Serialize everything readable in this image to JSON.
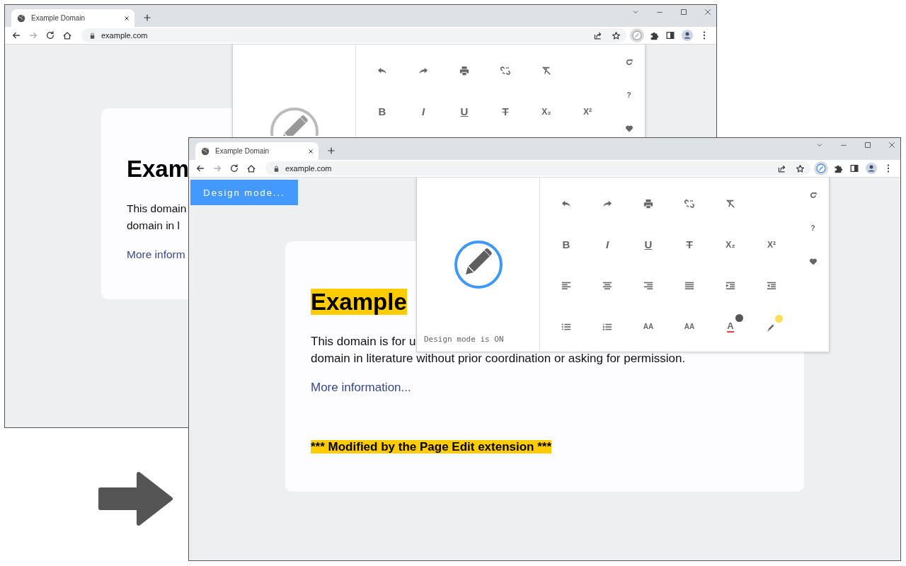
{
  "windows": [
    {
      "tab": {
        "title": "Example Domain"
      },
      "address": "example.com",
      "forward_enabled": false,
      "extension_active": false,
      "page": {
        "blocks": [
          {
            "kind": "heading",
            "text": "Exam",
            "highlighted": false
          },
          {
            "kind": "paragraph",
            "lines": [
              "This domain",
              "domain in l"
            ]
          },
          {
            "kind": "link",
            "text": "More inform"
          }
        ]
      },
      "popup": {
        "design_mode": false,
        "rows": [
          [
            {
              "kind": "undo"
            },
            {
              "kind": "redo"
            },
            {
              "kind": "print"
            },
            {
              "kind": "unlink"
            },
            {
              "kind": "clear-format"
            }
          ],
          [
            {
              "kind": "glyph",
              "label": "B"
            },
            {
              "kind": "glyph",
              "label": "I"
            },
            {
              "kind": "glyph",
              "label": "U"
            },
            {
              "kind": "glyph",
              "label": "T"
            },
            {
              "kind": "glyph",
              "label": "X₂"
            },
            {
              "kind": "glyph",
              "label": "X²"
            }
          ]
        ],
        "side": [
          {
            "kind": "refresh"
          },
          {
            "kind": "glyph",
            "label": "?"
          },
          {
            "kind": "heart"
          }
        ]
      }
    },
    {
      "tab": {
        "title": "Example Domain"
      },
      "address": "example.com",
      "forward_enabled": false,
      "extension_active": true,
      "banner": "Design mode...",
      "page": {
        "blocks": [
          {
            "kind": "heading",
            "text": "Example",
            "highlighted": true
          },
          {
            "kind": "paragraph",
            "lines": [
              "This domain is for u",
              "domain in literature without prior coordination or asking for permission."
            ]
          },
          {
            "kind": "link",
            "text": "More information..."
          },
          {
            "kind": "note",
            "text": "*** Modified by the Page Edit extension ***",
            "highlighted": true
          }
        ]
      },
      "popup": {
        "design_mode": true,
        "status": "Design mode is ON",
        "rows": [
          [
            {
              "kind": "undo"
            },
            {
              "kind": "redo"
            },
            {
              "kind": "print"
            },
            {
              "kind": "unlink"
            },
            {
              "kind": "clear-format"
            }
          ],
          [
            {
              "kind": "glyph",
              "label": "B"
            },
            {
              "kind": "glyph",
              "label": "I"
            },
            {
              "kind": "glyph",
              "label": "U"
            },
            {
              "kind": "glyph",
              "label": "T"
            },
            {
              "kind": "glyph",
              "label": "X₂"
            },
            {
              "kind": "glyph",
              "label": "X²"
            }
          ],
          [
            {
              "kind": "align-left"
            },
            {
              "kind": "align-center"
            },
            {
              "kind": "align-right"
            },
            {
              "kind": "justify"
            },
            {
              "kind": "indent"
            },
            {
              "kind": "outdent"
            }
          ],
          [
            {
              "kind": "bullets"
            },
            {
              "kind": "numbers"
            },
            {
              "kind": "glyph",
              "label": "AA"
            },
            {
              "kind": "glyph",
              "label": "AA"
            },
            {
              "kind": "text-color",
              "label": "A",
              "color": "#555555"
            },
            {
              "kind": "highlight",
              "color": "#ffdd55"
            }
          ]
        ],
        "side": [
          {
            "kind": "refresh"
          },
          {
            "kind": "glyph",
            "label": "?"
          },
          {
            "kind": "heart"
          }
        ]
      }
    }
  ]
}
